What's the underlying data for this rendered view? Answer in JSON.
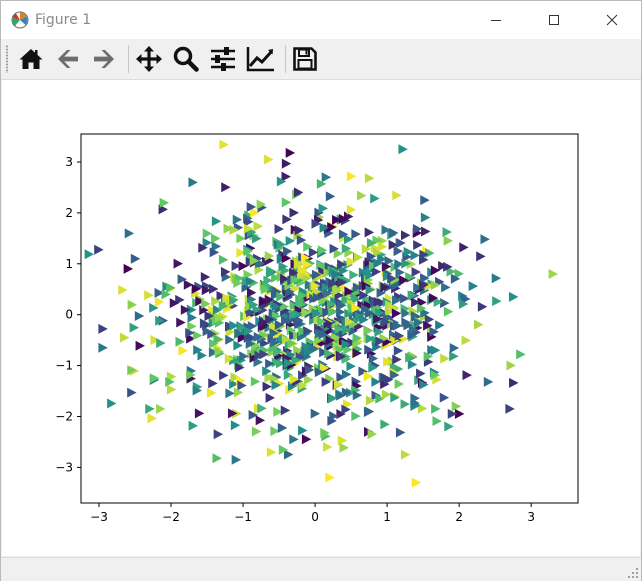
{
  "window": {
    "title": "Figure 1",
    "icon": "matplotlib-logo-icon",
    "controls": [
      "minimize-icon",
      "maximize-icon",
      "close-icon"
    ]
  },
  "toolbar": {
    "tools": [
      {
        "name": "home-button",
        "icon": "home-icon"
      },
      {
        "name": "back-button",
        "icon": "arrow-left-icon"
      },
      {
        "name": "forward-button",
        "icon": "arrow-right-icon"
      },
      {
        "name": "pan-button",
        "icon": "move-icon"
      },
      {
        "name": "zoom-button",
        "icon": "magnifier-icon"
      },
      {
        "name": "configure-subplots-button",
        "icon": "sliders-icon"
      },
      {
        "name": "edit-axes-button",
        "icon": "line-chart-icon"
      },
      {
        "name": "save-button",
        "icon": "floppy-disk-icon"
      }
    ]
  },
  "colors": {
    "viridis": [
      "#440154",
      "#3b528b",
      "#21918c",
      "#5ec962",
      "#fde725"
    ]
  },
  "chart_data": {
    "type": "scatter",
    "marker": "triangle-right",
    "colormap": "viridis",
    "xlim": [
      -3.25,
      3.65
    ],
    "ylim": [
      -3.7,
      3.55
    ],
    "xticks": [
      -3,
      -2,
      -1,
      0,
      1,
      2,
      3
    ],
    "yticks": [
      -3,
      -2,
      -1,
      0,
      1,
      2,
      3
    ],
    "grid": false,
    "approx_points": 1000,
    "outliers": [
      {
        "x": -0.35,
        "y": 3.18,
        "c": 0.0
      },
      {
        "x": -0.65,
        "y": 3.05,
        "c": 0.95
      },
      {
        "x": 0.15,
        "y": 2.7,
        "c": 0.4
      },
      {
        "x": 0.5,
        "y": 2.72,
        "c": 1.0
      },
      {
        "x": 0.75,
        "y": 2.68,
        "c": 0.9
      },
      {
        "x": -1.7,
        "y": 2.6,
        "c": 0.4
      },
      {
        "x": -2.1,
        "y": 2.2,
        "c": 0.75
      },
      {
        "x": -2.95,
        "y": -0.28,
        "c": 0.2
      },
      {
        "x": -2.95,
        "y": -0.65,
        "c": 0.4
      },
      {
        "x": -2.65,
        "y": -0.45,
        "c": 0.9
      },
      {
        "x": -2.6,
        "y": 0.9,
        "c": 0.0
      },
      {
        "x": -2.5,
        "y": 1.1,
        "c": 0.3
      },
      {
        "x": 3.3,
        "y": 0.8,
        "c": 0.85
      },
      {
        "x": 2.85,
        "y": -0.78,
        "c": 0.7
      },
      {
        "x": 2.7,
        "y": -1.85,
        "c": 0.2
      },
      {
        "x": 2.75,
        "y": 0.35,
        "c": 0.5
      },
      {
        "x": -1.1,
        "y": -2.85,
        "c": 0.4
      },
      {
        "x": -1.35,
        "y": -2.35,
        "c": 0.2
      },
      {
        "x": 0.2,
        "y": -3.2,
        "c": 1.0
      },
      {
        "x": 1.4,
        "y": -3.3,
        "c": 1.0
      },
      {
        "x": 1.25,
        "y": -2.75,
        "c": 0.9
      },
      {
        "x": -0.3,
        "y": -2.45,
        "c": 0.4
      },
      {
        "x": -2.3,
        "y": -1.85,
        "c": 0.6
      },
      {
        "x": -2.15,
        "y": -1.85,
        "c": 0.85
      },
      {
        "x": 2.0,
        "y": -1.95,
        "c": 0.0
      },
      {
        "x": 1.9,
        "y": -1.95,
        "c": 0.2
      }
    ]
  }
}
